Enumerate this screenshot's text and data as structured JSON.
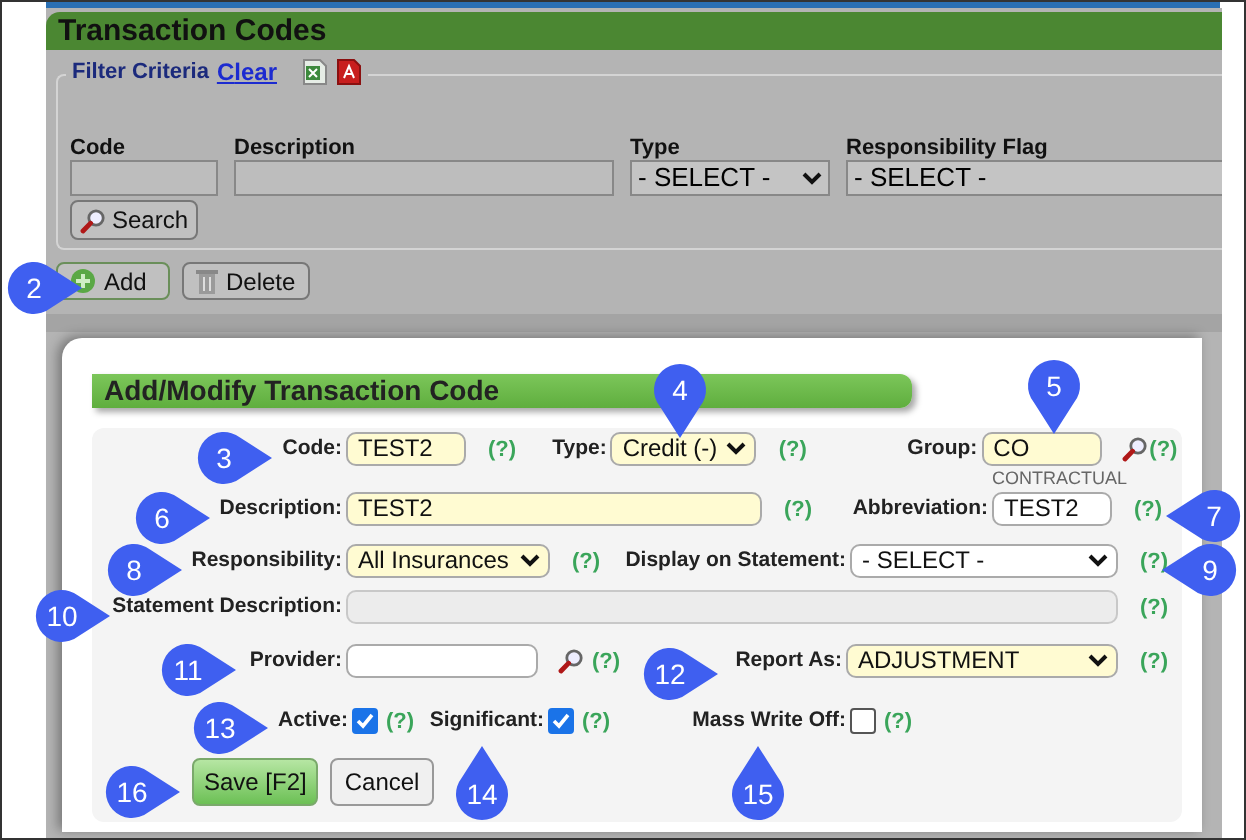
{
  "page": {
    "title": "Transaction Codes",
    "filter": {
      "legend": "Filter Criteria",
      "clear": "Clear",
      "fields": [
        {
          "kind": "text",
          "label": "Code"
        },
        {
          "kind": "text",
          "label": "Description"
        },
        {
          "kind": "select",
          "label": "Type",
          "value": "- SELECT -"
        },
        {
          "kind": "select",
          "label": "Responsibility Flag",
          "value": "- SELECT -"
        }
      ],
      "search_button": "Search"
    },
    "toolbar": [
      {
        "kind": "add",
        "label": "Add"
      },
      {
        "kind": "delete",
        "label": "Delete"
      }
    ]
  },
  "modal": {
    "title": "Add/Modify Transaction Code",
    "rows": [
      {
        "items": [
          {
            "kind": "label",
            "text": "Code:"
          },
          {
            "kind": "text",
            "value": "TEST2",
            "required": true
          },
          {
            "kind": "help",
            "text": "(?)"
          },
          {
            "kind": "label",
            "text": "Type:"
          },
          {
            "kind": "select",
            "value": "Credit (-)",
            "required": true
          },
          {
            "kind": "help",
            "text": "(?)"
          },
          {
            "kind": "label",
            "text": "Group:"
          },
          {
            "kind": "text",
            "value": "CO",
            "required": true
          },
          {
            "kind": "lookup"
          },
          {
            "kind": "help",
            "text": "(?)"
          }
        ]
      },
      {
        "items": [
          {
            "kind": "note",
            "text": "CONTRACTUAL"
          }
        ]
      },
      {
        "items": [
          {
            "kind": "label",
            "text": "Description:"
          },
          {
            "kind": "text",
            "value": "TEST2",
            "required": true
          },
          {
            "kind": "help",
            "text": "(?)"
          },
          {
            "kind": "label",
            "text": "Abbreviation:"
          },
          {
            "kind": "text",
            "value": "TEST2",
            "required": false
          },
          {
            "kind": "help",
            "text": "(?)"
          }
        ]
      },
      {
        "items": [
          {
            "kind": "label",
            "text": "Responsibility:"
          },
          {
            "kind": "select",
            "value": "All Insurances",
            "required": true
          },
          {
            "kind": "help",
            "text": "(?)"
          },
          {
            "kind": "label",
            "text": "Display on Statement:"
          },
          {
            "kind": "select",
            "value": "- SELECT -",
            "required": false
          },
          {
            "kind": "help",
            "text": "(?)"
          }
        ]
      },
      {
        "items": [
          {
            "kind": "label",
            "text": "Statement Description:"
          },
          {
            "kind": "text",
            "disabled": true
          },
          {
            "kind": "help",
            "text": "(?)"
          }
        ]
      },
      {
        "items": [
          {
            "kind": "label",
            "text": "Provider:"
          },
          {
            "kind": "text",
            "required": false
          },
          {
            "kind": "lookup"
          },
          {
            "kind": "help",
            "text": "(?)"
          },
          {
            "kind": "label",
            "text": "Report As:"
          },
          {
            "kind": "select",
            "value": "ADJUSTMENT",
            "required": true
          },
          {
            "kind": "help",
            "text": "(?)"
          }
        ]
      },
      {
        "items": [
          {
            "kind": "label",
            "text": "Active:"
          },
          {
            "kind": "checkbox",
            "checked": true
          },
          {
            "kind": "help",
            "text": "(?)"
          },
          {
            "kind": "label",
            "text": "Significant:"
          },
          {
            "kind": "checkbox",
            "checked": true
          },
          {
            "kind": "help",
            "text": "(?)"
          },
          {
            "kind": "label",
            "text": "Mass Write Off:"
          },
          {
            "kind": "checkbox",
            "checked": false
          },
          {
            "kind": "help",
            "text": "(?)"
          }
        ]
      }
    ],
    "buttons": [
      {
        "kind": "primary",
        "label": "Save [F2]"
      },
      {
        "kind": "secondary",
        "label": "Cancel"
      }
    ]
  },
  "callouts": [
    "2",
    "4",
    "5",
    "3",
    "6",
    "7",
    "8",
    "9",
    "10",
    "11",
    "12",
    "13",
    "16",
    "14",
    "15"
  ]
}
